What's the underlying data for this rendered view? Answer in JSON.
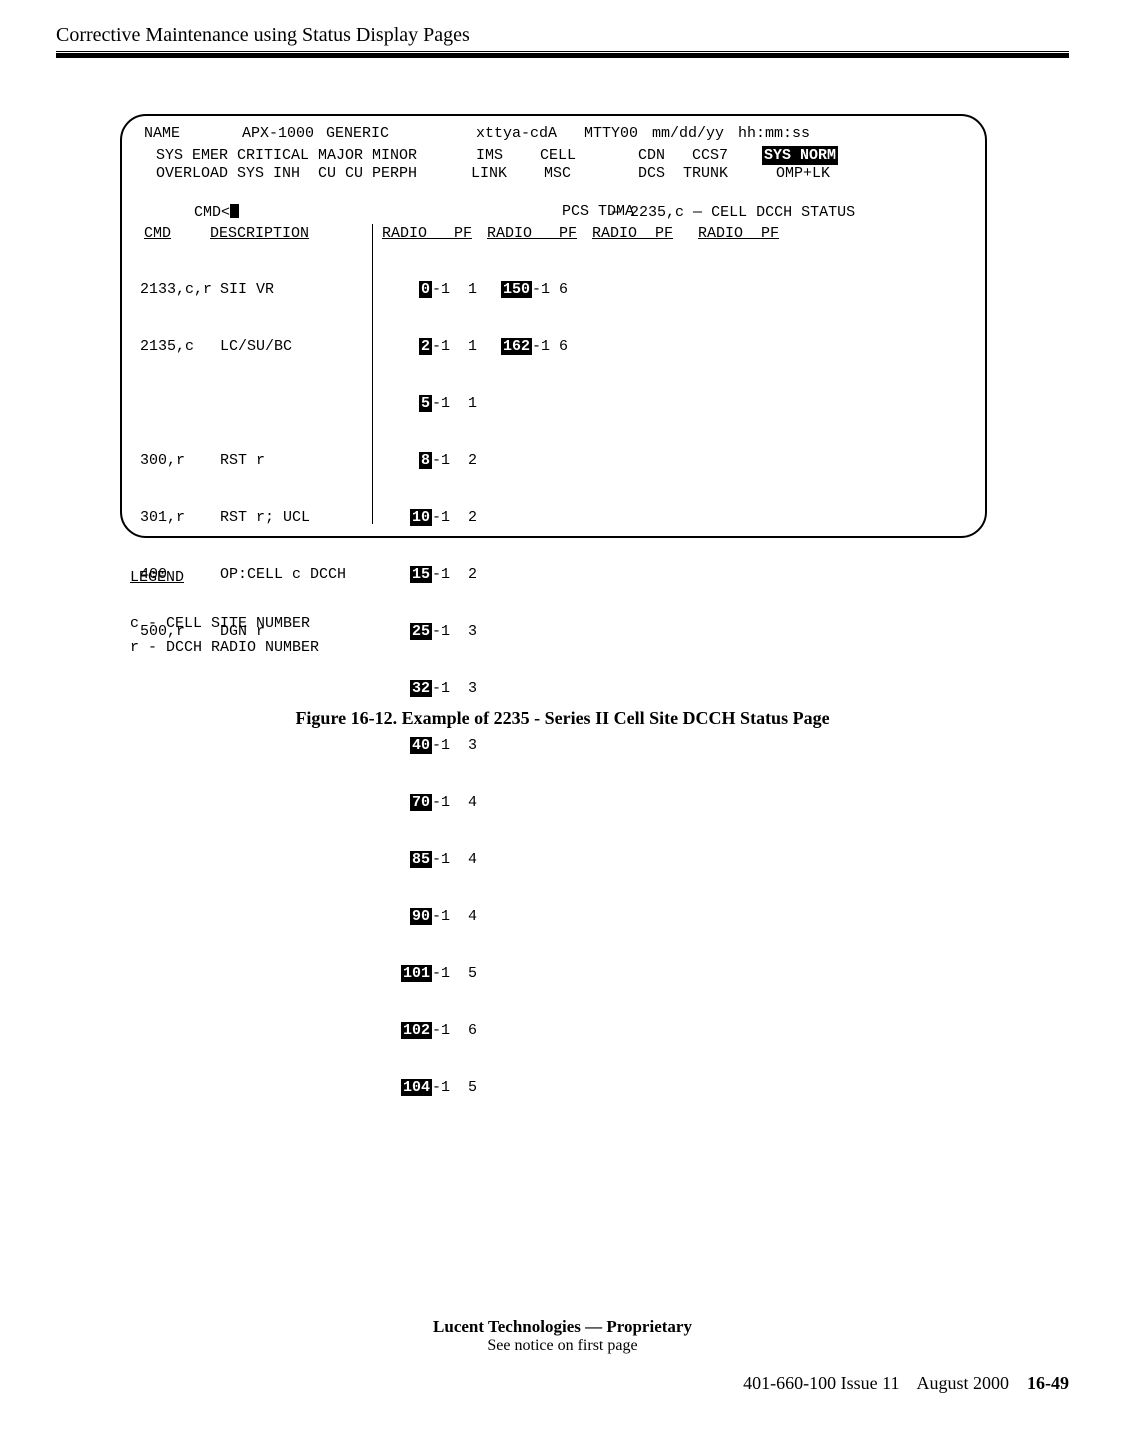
{
  "header": {
    "title": "Corrective Maintenance using Status Display Pages"
  },
  "term": {
    "row1": {
      "name": "NAME",
      "apx": "APX-1000",
      "generic": "GENERIC",
      "tty": "xttya-cdA",
      "mtty": "MTTY00",
      "date": "mm/dd/yy",
      "time": "hh:mm:ss"
    },
    "row2": {
      "labels": "SYS EMER CRITICAL MAJOR MINOR",
      "ims": "IMS",
      "cell": "CELL",
      "cdn": "CDN",
      "ccs7": "CCS7",
      "sysnorm": "SYS NORM"
    },
    "row3": {
      "labels": "OVERLOAD SYS INH  CU CU PERPH",
      "link": "LINK",
      "msc": "MSC",
      "dcs": "DCS",
      "trunk": "TRUNK",
      "omplk": "OMP+LK"
    },
    "row4": {
      "cmd": "CMD<",
      "code": "2235,c",
      "status": "CELL DCCH STATUS"
    },
    "row5": {
      "pcs": "PCS TDMA"
    },
    "columns": {
      "cmd_h": "CMD",
      "desc_h": "DESCRIPTION",
      "radio_h1": "RADIO   PF",
      "radio_h2": "RADIO   PF",
      "radio_h3": "RADIO  PF",
      "radio_h4": "RADIO  PF"
    },
    "cmds": [
      {
        "cmd": "2133,c,r",
        "desc": "SII VR"
      },
      {
        "cmd": "2135,c",
        "desc": "LC/SU/BC"
      },
      {
        "gap": true
      },
      {
        "cmd": "300,r",
        "desc": "RST r"
      },
      {
        "cmd": "301,r",
        "desc": "RST r; UCL"
      },
      {
        "cmd": "400",
        "desc": "OP:CELL c DCCH"
      },
      {
        "cmd": "500,r",
        "desc": "DGN r"
      }
    ],
    "radios_col1": [
      {
        "r": "0",
        "rest": "-1  1"
      },
      {
        "r": "2",
        "rest": "-1  1"
      },
      {
        "r": "5",
        "rest": "-1  1"
      },
      {
        "r": "8",
        "rest": "-1  2"
      },
      {
        "r": "10",
        "rest": "-1  2"
      },
      {
        "r": "15",
        "rest": "-1  2"
      },
      {
        "r": "25",
        "rest": "-1  3"
      },
      {
        "r": "32",
        "rest": "-1  3"
      },
      {
        "r": "40",
        "rest": "-1  3"
      },
      {
        "r": "70",
        "rest": "-1  4"
      },
      {
        "r": "85",
        "rest": "-1  4"
      },
      {
        "r": "90",
        "rest": "-1  4"
      },
      {
        "r": "101",
        "rest": "-1  5"
      },
      {
        "r": "102",
        "rest": "-1  6"
      },
      {
        "r": "104",
        "rest": "-1  5"
      }
    ],
    "radios_col2": [
      {
        "r": "150",
        "rest": "-1 6"
      },
      {
        "r": "162",
        "rest": "-1 6"
      }
    ]
  },
  "legend": {
    "hdr": "LEGEND",
    "items": [
      "c - CELL SITE NUMBER",
      "r - DCCH RADIO NUMBER"
    ]
  },
  "figure_caption": "Figure 16-12.  Example of 2235 - Series II Cell Site DCCH Status Page",
  "footer": {
    "prop1": "Lucent Technologies — Proprietary",
    "prop2": "See notice on first page",
    "doc": "401-660-100 Issue 11",
    "date": "August 2000",
    "page": "16-49"
  }
}
